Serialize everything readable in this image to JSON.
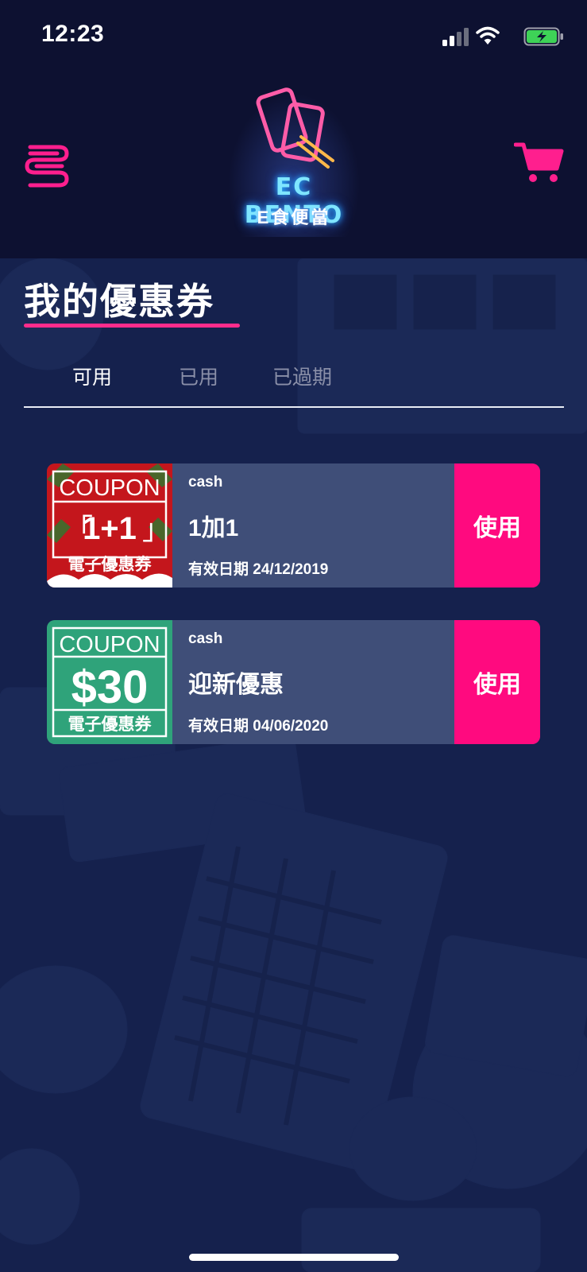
{
  "status_bar": {
    "time": "12:23",
    "icons": [
      "signal-icon",
      "wifi-icon",
      "battery-charging-icon"
    ]
  },
  "header": {
    "menu_icon": "menu-icon",
    "cart_icon": "cart-icon",
    "logo": {
      "text_en": "EC BENTO",
      "text_zh": "E食便當"
    }
  },
  "page": {
    "title": "我的優惠券"
  },
  "tabs": [
    {
      "label": "可用",
      "active": true
    },
    {
      "label": "已用",
      "active": false
    },
    {
      "label": "已過期",
      "active": false
    }
  ],
  "coupons": [
    {
      "thumb": {
        "line1": "COUPON",
        "line2": "1+1",
        "line3": "電子優惠券",
        "color": "#c4161c"
      },
      "type": "cash",
      "name": "1加1",
      "expiry": "有效日期 24/12/2019",
      "button": "使用"
    },
    {
      "thumb": {
        "line1": "COUPON",
        "line2": "$30",
        "line3": "電子優惠券",
        "color": "#2fa37a"
      },
      "type": "cash",
      "name": "迎新優惠",
      "expiry": "有效日期 04/06/2020",
      "button": "使用"
    }
  ],
  "colors": {
    "accent": "#ff0a7f",
    "background": "#0d1131",
    "card": "#3f4e78"
  }
}
